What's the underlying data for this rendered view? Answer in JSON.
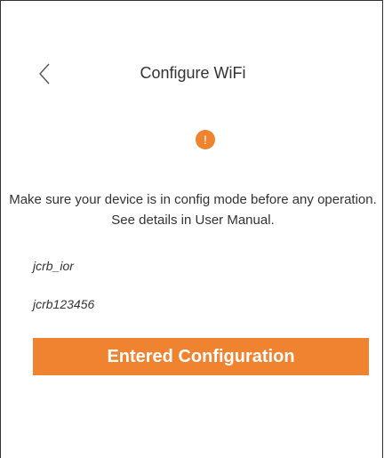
{
  "header": {
    "title": "Configure WiFi",
    "back_icon": "chevron-left-icon"
  },
  "notice": {
    "icon": "warning-icon",
    "icon_glyph": "!",
    "text": "Make sure your device is in config mode before any operation. See details in User Manual."
  },
  "fields": {
    "ssid": "jcrb_ior",
    "password": "jcrb123456"
  },
  "actions": {
    "confirm_label": "Entered Configuration"
  },
  "colors": {
    "accent": "#f08330",
    "text": "#333333",
    "background": "#ffffff"
  }
}
